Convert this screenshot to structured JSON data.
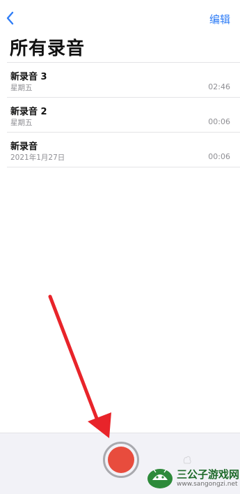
{
  "nav": {
    "back_icon": "chevron-left-icon",
    "edit_label": "编辑"
  },
  "page_title": "所有录音",
  "recordings": [
    {
      "title": "新录音 3",
      "date": "星期五",
      "duration": "02:46"
    },
    {
      "title": "新录音 2",
      "date": "星期五",
      "duration": "00:06"
    },
    {
      "title": "新录音",
      "date": "2021年1月27日",
      "duration": "00:06"
    }
  ],
  "record_button": {
    "icon": "record-icon",
    "color": "#e84c3d"
  },
  "annotation": {
    "icon": "red-arrow",
    "color": "#e8242a"
  },
  "watermark": {
    "title": "三公子游戏网",
    "url": "www.sangongzi.net"
  },
  "colors": {
    "accent": "#2f7df6",
    "record": "#e84c3d"
  }
}
